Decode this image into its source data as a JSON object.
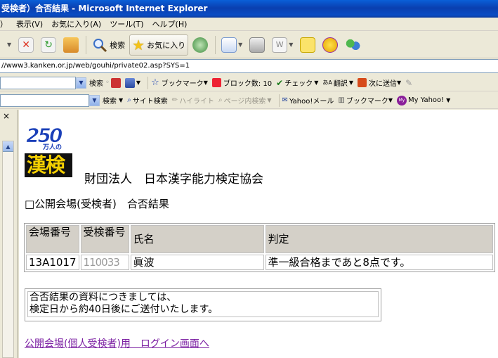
{
  "window": {
    "title": "受検者）合否結果 - Microsoft Internet Explorer"
  },
  "menu": {
    "items": [
      "）",
      "表示(V)",
      "お気に入り(A)",
      "ツール(T)",
      "ヘルプ(H)"
    ]
  },
  "toolbar": {
    "search_label": "検索",
    "favorites_label": "お気に入り"
  },
  "address": {
    "url": "//www3.kanken.or.jp/web/gouhi/private02.asp?SYS=1"
  },
  "yahoo_bar1": {
    "search_label": "検索",
    "bookmark_label": "ブックマーク",
    "blocked_label": "ブロック数: 10",
    "check_label": "チェック",
    "translate_label": "翻訳",
    "send_label": "次に送信"
  },
  "yahoo_bar2": {
    "search_label": "検索",
    "site_search_label": "サイト検索",
    "highlight_label": "ハイライト",
    "page_search_label": "ページ内検索",
    "mail_label": "Yahoo!メール",
    "bookmark_label": "ブックマーク",
    "my_yahoo_label": "My Yahoo!"
  },
  "left_pane": {
    "close": "×"
  },
  "logo": {
    "badge": "250",
    "sub_text": "万人の",
    "kanji": "漢検"
  },
  "page": {
    "org_name": "財団法人　日本漢字能力検定協会",
    "section_title": "□公開会場(受検者)　合否結果",
    "table": {
      "headers": [
        "会場番号",
        "受検番号",
        "氏名",
        "判定"
      ],
      "row": [
        "13A1017",
        "110033",
        "眞波",
        "準一級合格まであと8点です。"
      ]
    },
    "notice_line1": "合否結果の資料につきましては、",
    "notice_line2": "検定日から約40日後にご送付いたします。",
    "login_link": "公開会場(個人受検者)用　ログイン画面へ"
  },
  "colors": {
    "titlebar": "#0a4cc4",
    "link": "#7b1fa2",
    "logo_blue": "#1a3fb8",
    "logo_red": "#d8202a"
  }
}
